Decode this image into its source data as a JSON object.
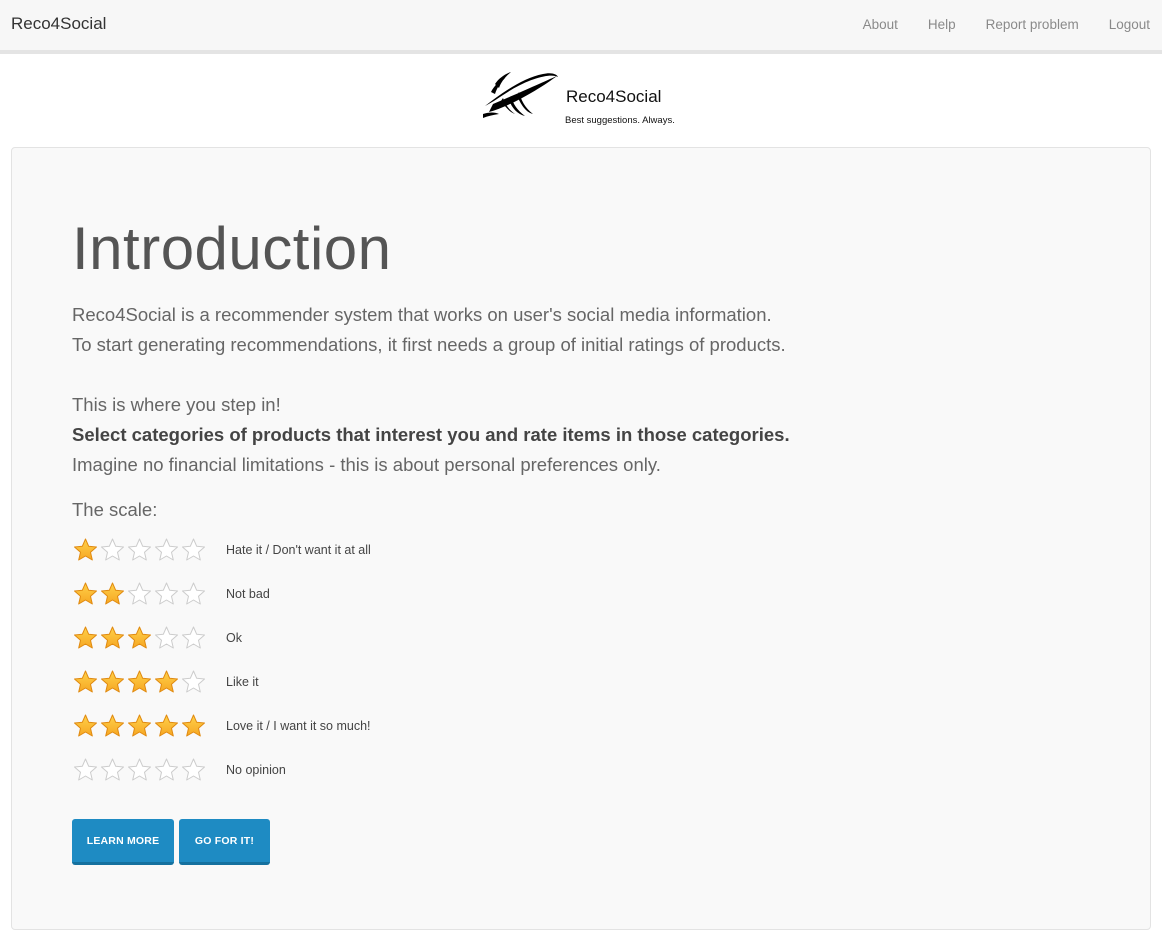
{
  "navbar": {
    "brand": "Reco4Social",
    "links": [
      "About",
      "Help",
      "Report problem",
      "Logout"
    ]
  },
  "logo": {
    "title": "Reco4Social",
    "tagline": "Best suggestions. Always."
  },
  "intro": {
    "heading": "Introduction",
    "p1": "Reco4Social is a recommender system that works on user's social media information.",
    "p2": "To start generating recommendations, it first needs a group of initial ratings of products.",
    "p3": "This is where you step in!",
    "p4": "Select categories of products that interest you and rate items in those categories.",
    "p5": "Imagine no financial limitations - this is about personal preferences only.",
    "scale_heading": "The scale:"
  },
  "scale": [
    {
      "stars": 1,
      "label": "Hate it / Don't want it at all"
    },
    {
      "stars": 2,
      "label": "Not bad"
    },
    {
      "stars": 3,
      "label": "Ok"
    },
    {
      "stars": 4,
      "label": "Like it"
    },
    {
      "stars": 5,
      "label": "Love it / I want it so much!"
    },
    {
      "stars": 0,
      "label": "No opinion"
    }
  ],
  "buttons": {
    "learn_more": "Learn more",
    "go_for_it": "Go for it!"
  },
  "colors": {
    "star_filled": "#f6a623",
    "star_empty_stroke": "#cccccc",
    "button": "#1e8bc3"
  },
  "icons": {
    "star_filled": "star-filled-icon",
    "star_empty": "star-empty-icon",
    "logo": "swirl-logo-icon"
  }
}
